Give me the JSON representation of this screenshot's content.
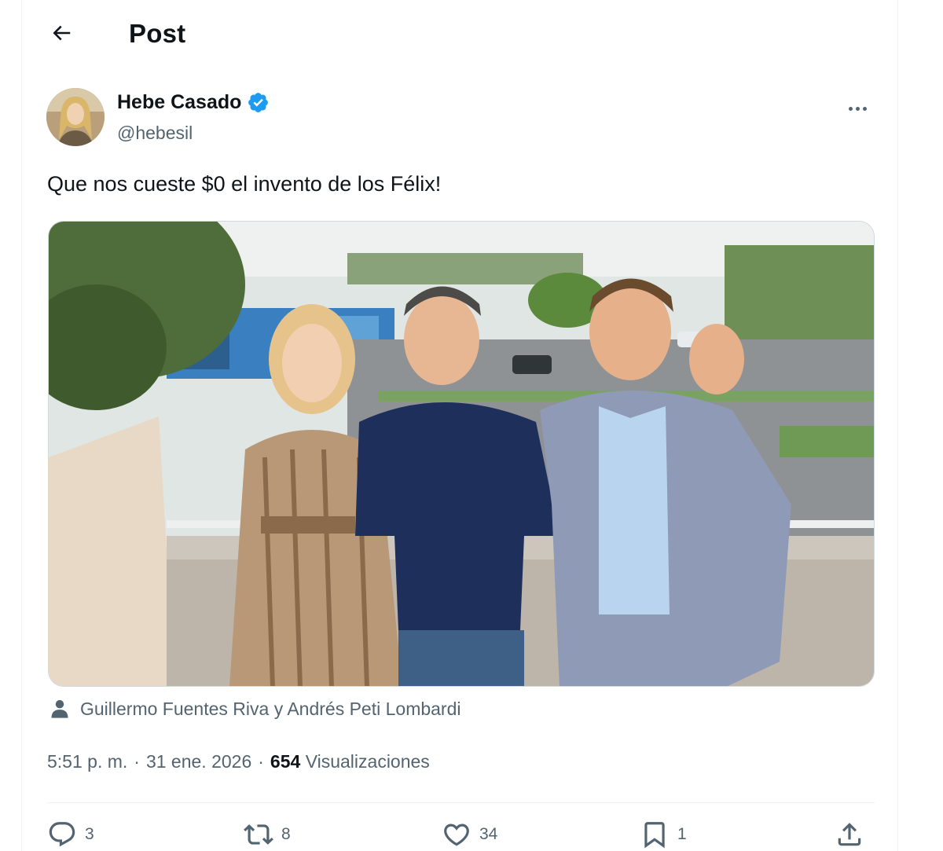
{
  "header": {
    "title": "Post"
  },
  "author": {
    "name": "Hebe Casado",
    "handle": "@hebesil",
    "verified": true
  },
  "post": {
    "text": "Que nos cueste $0 el invento de los Félix!",
    "tagged_people": "Guillermo Fuentes Riva y Andrés Peti Lombardi",
    "time": "5:51 p. m.",
    "date": "31 ene. 2026",
    "views_count": "654",
    "views_label": "Visualizaciones"
  },
  "actions": {
    "replies": "3",
    "reposts": "8",
    "likes": "34",
    "bookmarks": "1"
  },
  "colors": {
    "verified_blue": "#1d9bf0",
    "secondary_text": "#536471",
    "primary_text": "#0f1419",
    "divider": "#eff3f4"
  },
  "icons": [
    "back-arrow-icon",
    "verified-badge-icon",
    "more-options-icon",
    "person-icon",
    "reply-icon",
    "repost-icon",
    "like-icon",
    "bookmark-icon",
    "share-icon"
  ]
}
